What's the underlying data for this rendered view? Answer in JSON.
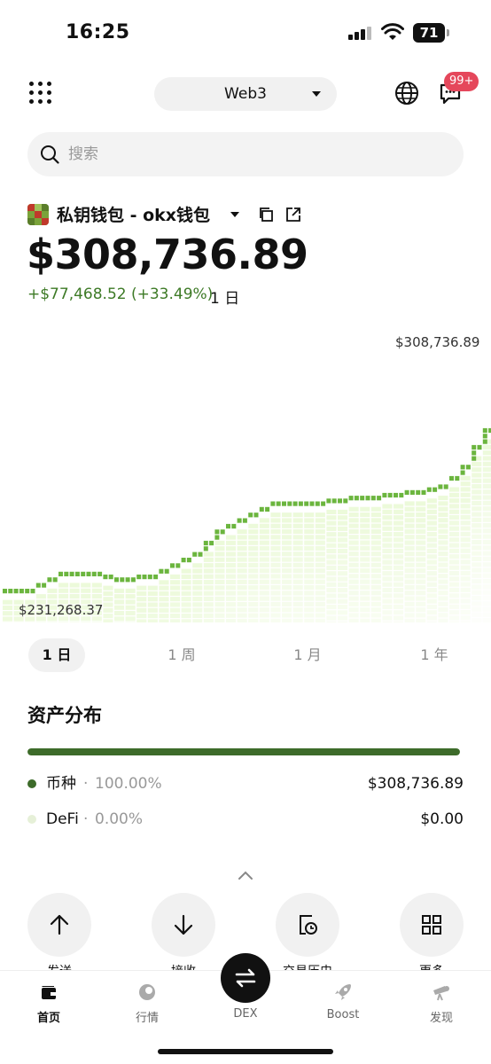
{
  "status_bar": {
    "time": "16:25",
    "battery": "71"
  },
  "header": {
    "network_label": "Web3",
    "message_badge": "99+"
  },
  "search": {
    "placeholder": "搜索"
  },
  "wallet": {
    "name": "私钥钱包 - okx钱包",
    "balance": "$308,736.89",
    "pnl": "+$77,468.52 (+33.49%)",
    "pnl_period": "1 日"
  },
  "chart_data": {
    "type": "line",
    "title": "",
    "max_label": "$308,736.89",
    "min_label": "$231,268.37",
    "ylim": [
      231268.37,
      308736.89
    ],
    "x": [
      0,
      1,
      2,
      3,
      4,
      5,
      6,
      7,
      8,
      9,
      10,
      11,
      12,
      13,
      14,
      15,
      16,
      17,
      18,
      19,
      20,
      21,
      22,
      23,
      24,
      25,
      26,
      27,
      28,
      29,
      30,
      31,
      32,
      33,
      34,
      35,
      36,
      37,
      38,
      39,
      40,
      41,
      42,
      43
    ],
    "values": [
      231268,
      231268,
      231268,
      233300,
      235300,
      237300,
      237300,
      237300,
      237300,
      236300,
      235300,
      235300,
      236300,
      236300,
      238300,
      240300,
      242300,
      244300,
      248300,
      252300,
      254300,
      256300,
      258300,
      260300,
      262300,
      262300,
      262300,
      262300,
      262300,
      263300,
      263300,
      264300,
      264300,
      264300,
      265300,
      265300,
      266300,
      266300,
      267300,
      268300,
      271300,
      275300,
      282300,
      288300
    ],
    "series_note": ""
  },
  "chart_meta": {
    "line_color": "#6bb53e",
    "fill_color": "#c6ef8f"
  },
  "period_tabs": [
    "1 日",
    "1 周",
    "1 月",
    "1 年"
  ],
  "active_period": "1 日",
  "allocation": {
    "title": "资产分布",
    "tokens_fraction": 1.0,
    "rows": [
      {
        "name": "币种",
        "sep": "·",
        "pct": "100.00%",
        "value": "$308,736.89",
        "color": "#3d6b2a"
      },
      {
        "name": "DeFi",
        "sep": "·",
        "pct": "0.00%",
        "value": "$0.00",
        "color": "#e6f0d8"
      }
    ]
  },
  "actions": [
    {
      "label": "发送",
      "icon": "arrow-up-icon"
    },
    {
      "label": "接收",
      "icon": "arrow-down-icon"
    },
    {
      "label": "交易历史",
      "icon": "history-icon"
    },
    {
      "label": "更多",
      "icon": "grid-icon"
    }
  ],
  "tabs": [
    {
      "label": "首页",
      "icon": "wallet-icon"
    },
    {
      "label": "行情",
      "icon": "market-icon"
    },
    {
      "label": "DEX",
      "icon": "swap-icon"
    },
    {
      "label": "Boost",
      "icon": "rocket-icon"
    },
    {
      "label": "发现",
      "icon": "discover-icon"
    }
  ]
}
